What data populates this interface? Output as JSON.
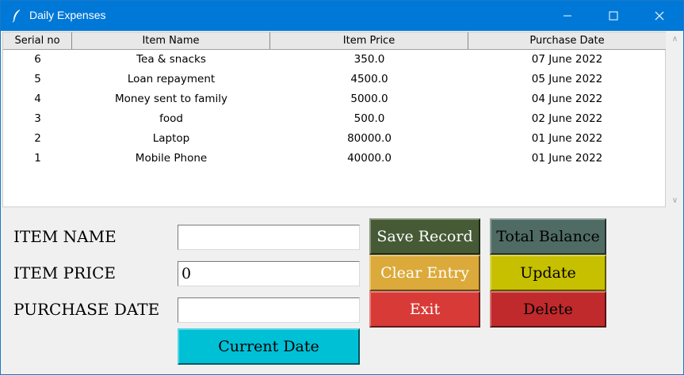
{
  "window": {
    "title": "Daily Expenses",
    "icon": "feather-icon",
    "controls": [
      "minimize-icon",
      "maximize-icon",
      "close-icon"
    ]
  },
  "table": {
    "headers": [
      "Serial no",
      "Item Name",
      "Item Price",
      "Purchase Date"
    ],
    "rows": [
      [
        "6",
        "Tea & snacks",
        "350.0",
        "07 June 2022"
      ],
      [
        "5",
        "Loan repayment",
        "4500.0",
        "05 June 2022"
      ],
      [
        "4",
        "Money sent to family",
        "5000.0",
        "04 June 2022"
      ],
      [
        "3",
        "food",
        "500.0",
        "02 June 2022"
      ],
      [
        "2",
        "Laptop",
        "80000.0",
        "01 June 2022"
      ],
      [
        "1",
        "Mobile Phone",
        "40000.0",
        "01 June 2022"
      ]
    ]
  },
  "form": {
    "item_name_label": "ITEM NAME",
    "item_price_label": "ITEM PRICE",
    "purchase_date_label": "PURCHASE DATE",
    "item_name_value": "",
    "item_price_value": "0",
    "purchase_date_value": ""
  },
  "buttons": {
    "save": "Save Record",
    "clear": "Clear Entry",
    "exit": "Exit",
    "current_date": "Current Date",
    "total_balance": "Total Balance",
    "update": "Update",
    "delete": "Delete"
  },
  "colors": {
    "titlebar": "#0078d7",
    "save": "#455a35",
    "clear": "#dcaa3a",
    "exit": "#d83a37",
    "current_date": "#00c0d6",
    "total_balance": "#4f6b64",
    "update": "#c7c000",
    "delete": "#c02a2c"
  }
}
